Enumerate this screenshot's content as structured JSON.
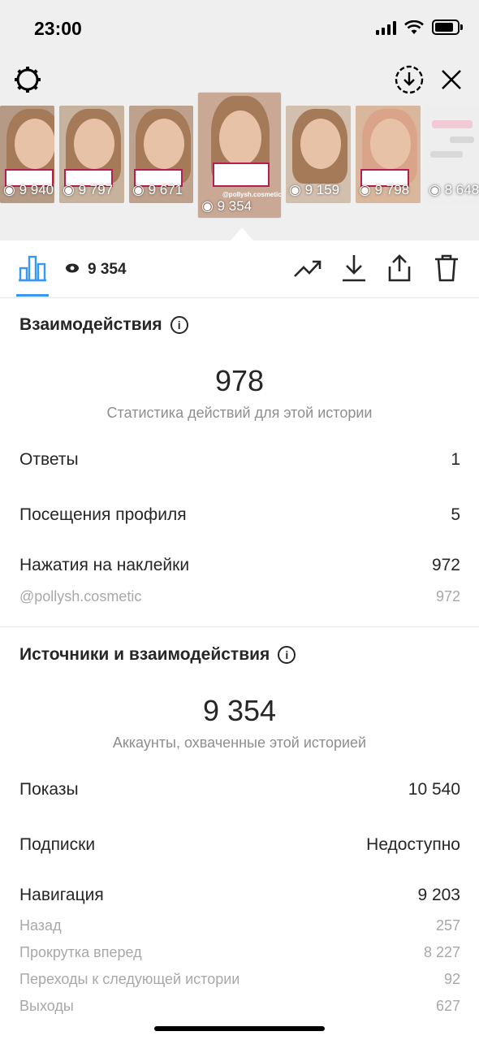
{
  "status_bar": {
    "time": "23:00"
  },
  "thumbnails": [
    {
      "count": "9 940",
      "bg": "#b59b86"
    },
    {
      "count": "9 797",
      "bg": "#c7b29d"
    },
    {
      "count": "9 671",
      "bg": "#bfa28d"
    },
    {
      "count": "9 354",
      "bg": "#c9a996",
      "handle": "@pollysh.cosmetic"
    },
    {
      "count": "9 159",
      "bg": "#d3bfae"
    },
    {
      "count": "9 798",
      "bg": "#d9b79d"
    },
    {
      "count": "8 648",
      "bg": "#eeeeee"
    }
  ],
  "toolbar": {
    "views": "9 354"
  },
  "interactions": {
    "title": "Взаимодействия",
    "total": "978",
    "total_caption": "Статистика действий для этой истории",
    "rows": [
      {
        "label": "Ответы",
        "value": "1"
      },
      {
        "label": "Посещения профиля",
        "value": "5"
      },
      {
        "label": "Нажатия на наклейки",
        "value": "972"
      }
    ],
    "sub_rows": [
      {
        "label": "@pollysh.cosmetic",
        "value": "972"
      }
    ]
  },
  "reach": {
    "title": "Источники и взаимодействия",
    "total": "9 354",
    "total_caption": "Аккаунты, охваченные этой историей",
    "rows": [
      {
        "label": "Показы",
        "value": "10 540"
      },
      {
        "label": "Подписки",
        "value": "Недоступно"
      },
      {
        "label": "Навигация",
        "value": "9 203"
      }
    ],
    "nav_rows": [
      {
        "label": "Назад",
        "value": "257"
      },
      {
        "label": "Прокрутка вперед",
        "value": "8 227"
      },
      {
        "label": "Переходы к следующей истории",
        "value": "92"
      },
      {
        "label": "Выходы",
        "value": "627"
      }
    ]
  },
  "colors": {
    "accent": "#3897f0",
    "text": "#262626",
    "muted": "#8e8e8e",
    "sticker": "#b51f4f"
  },
  "icons": [
    "gear-icon",
    "save-icon",
    "close-icon",
    "bar-chart-icon",
    "eye-icon",
    "trending-icon",
    "download-icon",
    "share-icon",
    "trash-icon",
    "info-icon"
  ]
}
